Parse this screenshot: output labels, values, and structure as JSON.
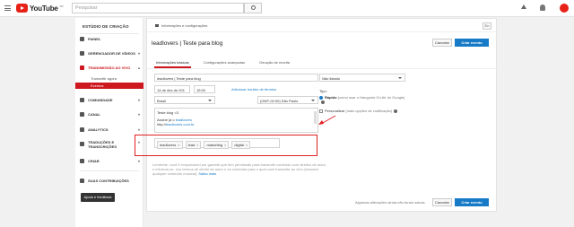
{
  "header": {
    "logo_text": "YouTube",
    "logo_sup": "BR",
    "search_placeholder": "Pesquisar"
  },
  "sidebar": {
    "studio_title": "ESTÚDIO DE CRIAÇÃO",
    "items": [
      {
        "label": "PAINEL"
      },
      {
        "label": "GERENCIADOR DE VÍDEOS"
      },
      {
        "label": "TRANSMISSÃO AO VIVO"
      },
      {
        "label": "COMUNIDADE"
      },
      {
        "label": "CANAL"
      },
      {
        "label": "ANALYTICS"
      },
      {
        "label": "TRADUÇÕES E TRANSCRIÇÕES"
      },
      {
        "label": "CRIAR"
      },
      {
        "label": "SUAS CONTRIBUIÇÕES"
      }
    ],
    "subitems": [
      {
        "label": "Transmitir agora"
      },
      {
        "label": "Eventos"
      }
    ],
    "feedback_button": "Ajuda e feedback"
  },
  "card": {
    "breadcrumb": "Informações e configurações",
    "collapse_label": "En",
    "event_title": "leadlovers | Teste para blog",
    "cancel_label": "Cancelar",
    "save_label": "Criar evento",
    "tabs": [
      {
        "label": "Informações básicas"
      },
      {
        "label": "Configurações avançadas"
      },
      {
        "label": "Geração de receita"
      }
    ],
    "form": {
      "title_value": "leadlovers | Teste para blog",
      "date_value": "14 de dez de 201",
      "time_value": "15:00",
      "add_end_time_link": "Adicionar horário de término",
      "country_value": "Brasil",
      "timezone_value": "(GMT-02:00) São Paulo",
      "description_line1": "Teste blog <3",
      "description_line2": "Assine já o",
      "description_link1": "leadlovers",
      "description_line3": "http://",
      "description_link2": "leadlovers.com.br",
      "tags": [
        {
          "label": "leadlovers"
        },
        {
          "label": "lead"
        },
        {
          "label": "marketing"
        },
        {
          "label": "digital"
        }
      ],
      "note_text": "Lembrete: você é responsável por garantir que tem permissão para transmitir conteúdo com direitos de autor, e informar-se, nos termos de direito de autor e do conteúdo para o qual você transmite ao vivo (inclusive qualquer conteúdo musical).",
      "note_link": "Saiba mais"
    },
    "privacy_value": "Não listado",
    "type_label": "Tipo:",
    "type_quick_label": "Rápido",
    "type_quick_desc": "(como usar o Hangouts On Air do Google)",
    "type_custom_label": "Personalizar",
    "type_custom_desc": "(mais opções de codificação)",
    "bottom_status": "Algumas alterações ainda não foram salvas",
    "bottom_cancel": "Cancelar",
    "bottom_save": "Criar evento"
  },
  "colors": {
    "accent_red": "#cc181e",
    "primary_blue": "#167ac6",
    "annotation_red": "#e02020"
  }
}
